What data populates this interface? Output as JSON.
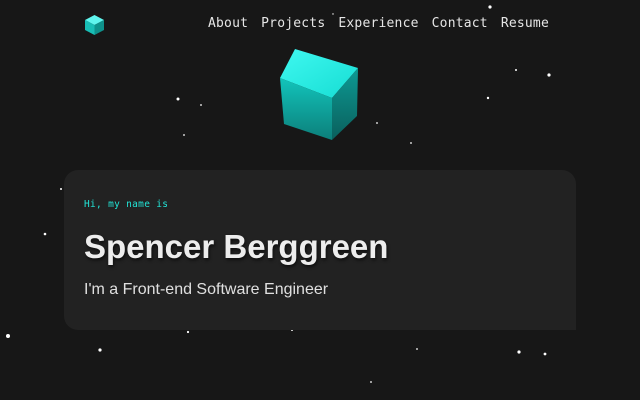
{
  "nav": {
    "items": [
      "About",
      "Projects",
      "Experience",
      "Contact",
      "Resume"
    ]
  },
  "hero": {
    "intro": "Hi, my name is",
    "name": "Spencer Berggreen",
    "role": "I'm a Front-end Software Engineer"
  },
  "icons": {
    "logo": "cube-logo-icon",
    "hero_graphic": "cube-icon"
  },
  "colors": {
    "background": "#171717",
    "card": "#222222",
    "accent": "#22e3d6",
    "text": "#ededed"
  }
}
